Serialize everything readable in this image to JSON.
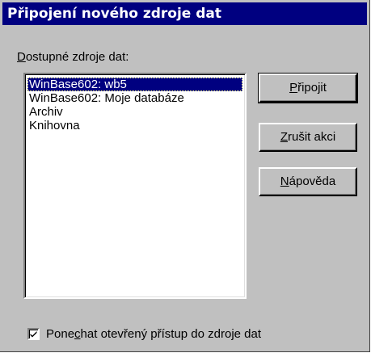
{
  "dialog": {
    "title": "Připojení nového zdroje dat"
  },
  "sources": {
    "label_prefix": "D",
    "label_rest": "ostupné zdroje dat:",
    "items": [
      {
        "label": "WinBase602: wb5",
        "selected": true
      },
      {
        "label": "WinBase602: Moje databáze",
        "selected": false
      },
      {
        "label": "Archiv",
        "selected": false
      },
      {
        "label": "Knihovna",
        "selected": false
      }
    ]
  },
  "buttons": {
    "connect": {
      "mnemonic": "P",
      "rest": "řipojit"
    },
    "cancel": {
      "mnemonic": "Z",
      "rest": "rušit akci"
    },
    "help": {
      "mnemonic": "N",
      "rest": "ápověda"
    }
  },
  "keep_open": {
    "checked": true,
    "label_pre": "Pone",
    "label_mnemonic": "c",
    "label_post": "hat otevřený přístup do zdroje dat"
  }
}
